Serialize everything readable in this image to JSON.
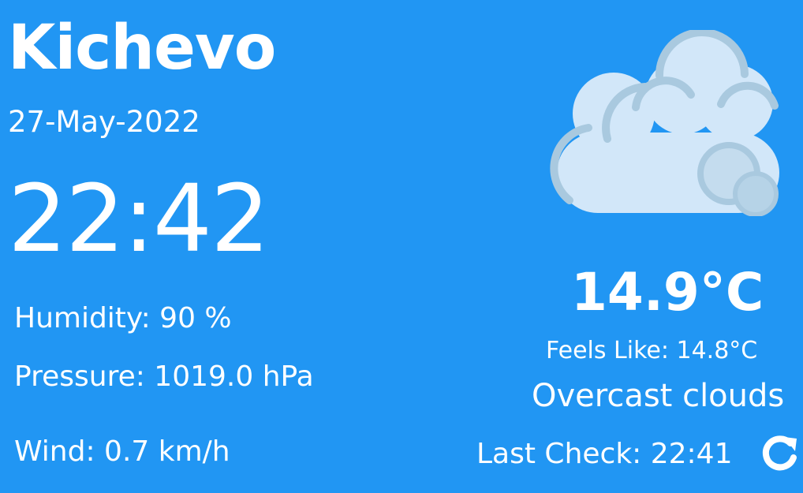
{
  "location": {
    "city": "Kichevo",
    "date": "27-May-2022",
    "time": "22:42"
  },
  "details": {
    "humidity": "Humidity: 90 %",
    "pressure": "Pressure: 1019.0 hPa",
    "wind": "Wind: 0.7 km/h"
  },
  "weather": {
    "icon": "overcast-clouds-icon",
    "temperature": "14.9°C",
    "feels_like": "Feels Like: 14.8°C",
    "description": "Overcast clouds"
  },
  "status": {
    "last_check": "Last Check: 22:41",
    "refresh_icon": "refresh-icon"
  },
  "colors": {
    "background": "#2196F3",
    "text": "#FFFFFF",
    "cloud_fill": "#D2E7F9",
    "cloud_outline": "#A9C9DF"
  }
}
